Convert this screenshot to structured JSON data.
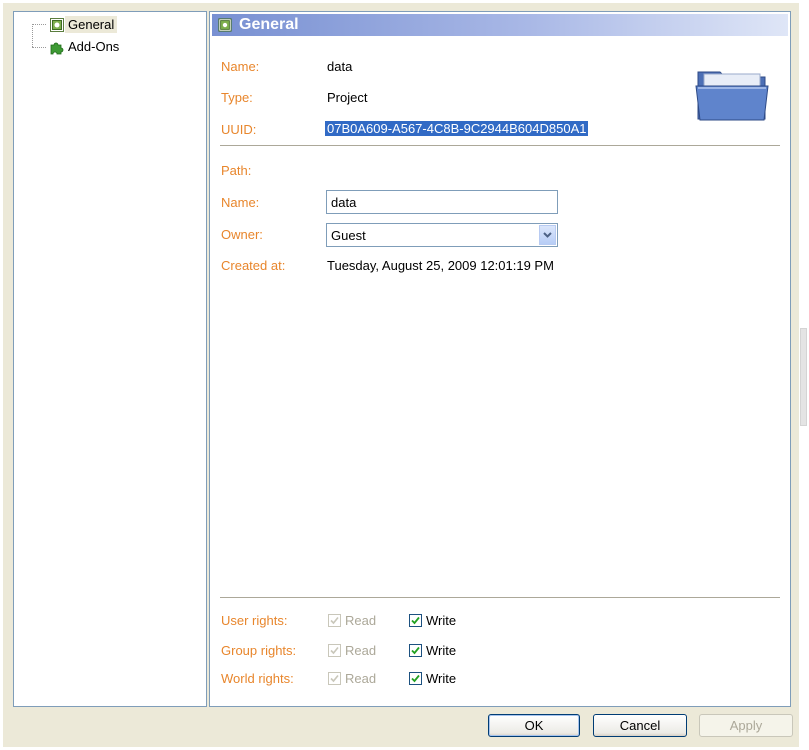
{
  "tree": {
    "items": [
      {
        "label": "General",
        "icon": "general-page-icon",
        "selected": true
      },
      {
        "label": "Add-Ons",
        "icon": "puzzle-piece-icon",
        "selected": false
      }
    ]
  },
  "panel": {
    "title": "General",
    "title_icon": "general-page-icon",
    "folder_icon": "folder-icon"
  },
  "info": {
    "name_label": "Name:",
    "name_value": "data",
    "type_label": "Type:",
    "type_value": "Project",
    "uuid_label": "UUID:",
    "uuid_value": "07B0A609-A567-4C8B-9C2944B604D850A1"
  },
  "path": {
    "path_label": "Path:",
    "name_label": "Name:",
    "name_value": "data",
    "owner_label": "Owner:",
    "owner_value": "Guest",
    "created_label": "Created at:",
    "created_value": "Tuesday, August 25, 2009 12:01:19 PM"
  },
  "rights": {
    "rows": [
      {
        "label": "User rights:",
        "read": "Read",
        "write": "Write",
        "read_checked": true,
        "read_enabled": false,
        "write_checked": true
      },
      {
        "label": "Group rights:",
        "read": "Read",
        "write": "Write",
        "read_checked": true,
        "read_enabled": false,
        "write_checked": true
      },
      {
        "label": "World rights:",
        "read": "Read",
        "write": "Write",
        "read_checked": true,
        "read_enabled": false,
        "write_checked": true
      }
    ]
  },
  "buttons": {
    "ok": "OK",
    "cancel": "Cancel",
    "apply": "Apply",
    "apply_enabled": false
  },
  "colors": {
    "label_orange": "#e8862c",
    "selection_blue": "#316ac5",
    "header_blue": "#7890d2"
  }
}
